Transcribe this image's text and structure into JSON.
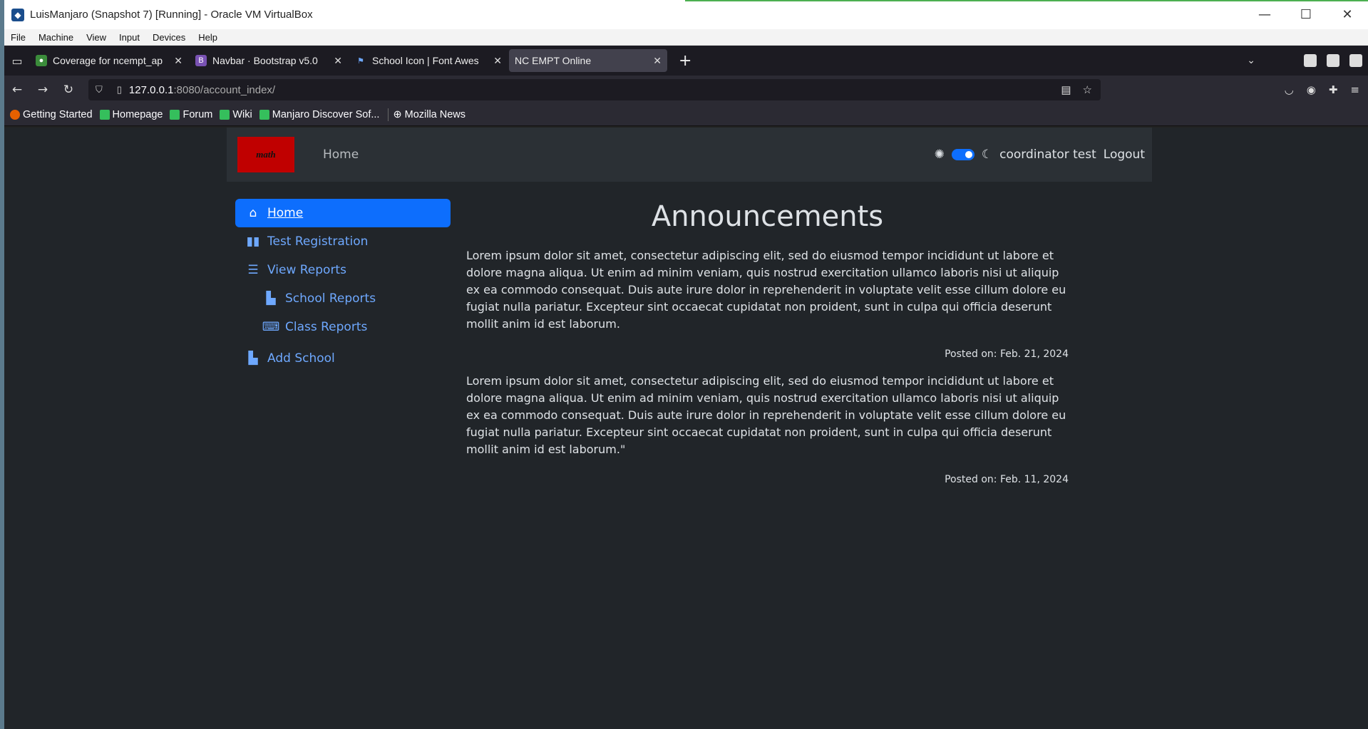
{
  "vbox": {
    "title": "LuisManjaro (Snapshot 7) [Running] - Oracle VM VirtualBox",
    "menu": [
      "File",
      "Machine",
      "View",
      "Input",
      "Devices",
      "Help"
    ]
  },
  "browser": {
    "tabs": [
      {
        "title": "Coverage for ncempt_ap",
        "active": false
      },
      {
        "title": "Navbar · Bootstrap v5.0",
        "active": false
      },
      {
        "title": "School Icon | Font Awes",
        "active": false
      },
      {
        "title": "NC EMPT Online",
        "active": true
      }
    ],
    "url_host": "127.0.0.1",
    "url_path": ":8080/account_index/",
    "bookmarks": [
      "Getting Started",
      "Homepage",
      "Forum",
      "Wiki",
      "Manjaro Discover Sof...",
      "Mozilla News"
    ]
  },
  "site": {
    "logo_text": "math",
    "nav_home": "Home",
    "user": "coordinator test",
    "logout": "Logout"
  },
  "sidebar": {
    "items": [
      {
        "label": "Home"
      },
      {
        "label": "Test Registration"
      },
      {
        "label": "View Reports"
      },
      {
        "label": "School Reports"
      },
      {
        "label": "Class Reports"
      },
      {
        "label": "Add School"
      }
    ]
  },
  "main": {
    "heading": "Announcements",
    "posts": [
      {
        "body": "Lorem ipsum dolor sit amet, consectetur adipiscing elit, sed do eiusmod tempor incididunt ut labore et dolore magna aliqua. Ut enim ad minim veniam, quis nostrud exercitation ullamco laboris nisi ut aliquip ex ea commodo consequat. Duis aute irure dolor in reprehenderit in voluptate velit esse cillum dolore eu fugiat nulla pariatur. Excepteur sint occaecat cupidatat non proident, sunt in culpa qui officia deserunt mollit anim id est laborum.",
        "posted": "Posted on: Feb. 21, 2024"
      },
      {
        "body": "Lorem ipsum dolor sit amet, consectetur adipiscing elit, sed do eiusmod tempor incididunt ut labore et dolore magna aliqua. Ut enim ad minim veniam, quis nostrud exercitation ullamco laboris nisi ut aliquip ex ea commodo consequat. Duis aute irure dolor in reprehenderit in voluptate velit esse cillum dolore eu fugiat nulla pariatur. Excepteur sint occaecat cupidatat non proident, sunt in culpa qui officia deserunt mollit anim id est laborum.\"",
        "posted": "Posted on: Feb. 11, 2024"
      }
    ]
  },
  "colors": {
    "accent": "#0d6efd",
    "link": "#6ea8fe",
    "page_bg": "#212529",
    "nav_bg": "#2b3035"
  }
}
